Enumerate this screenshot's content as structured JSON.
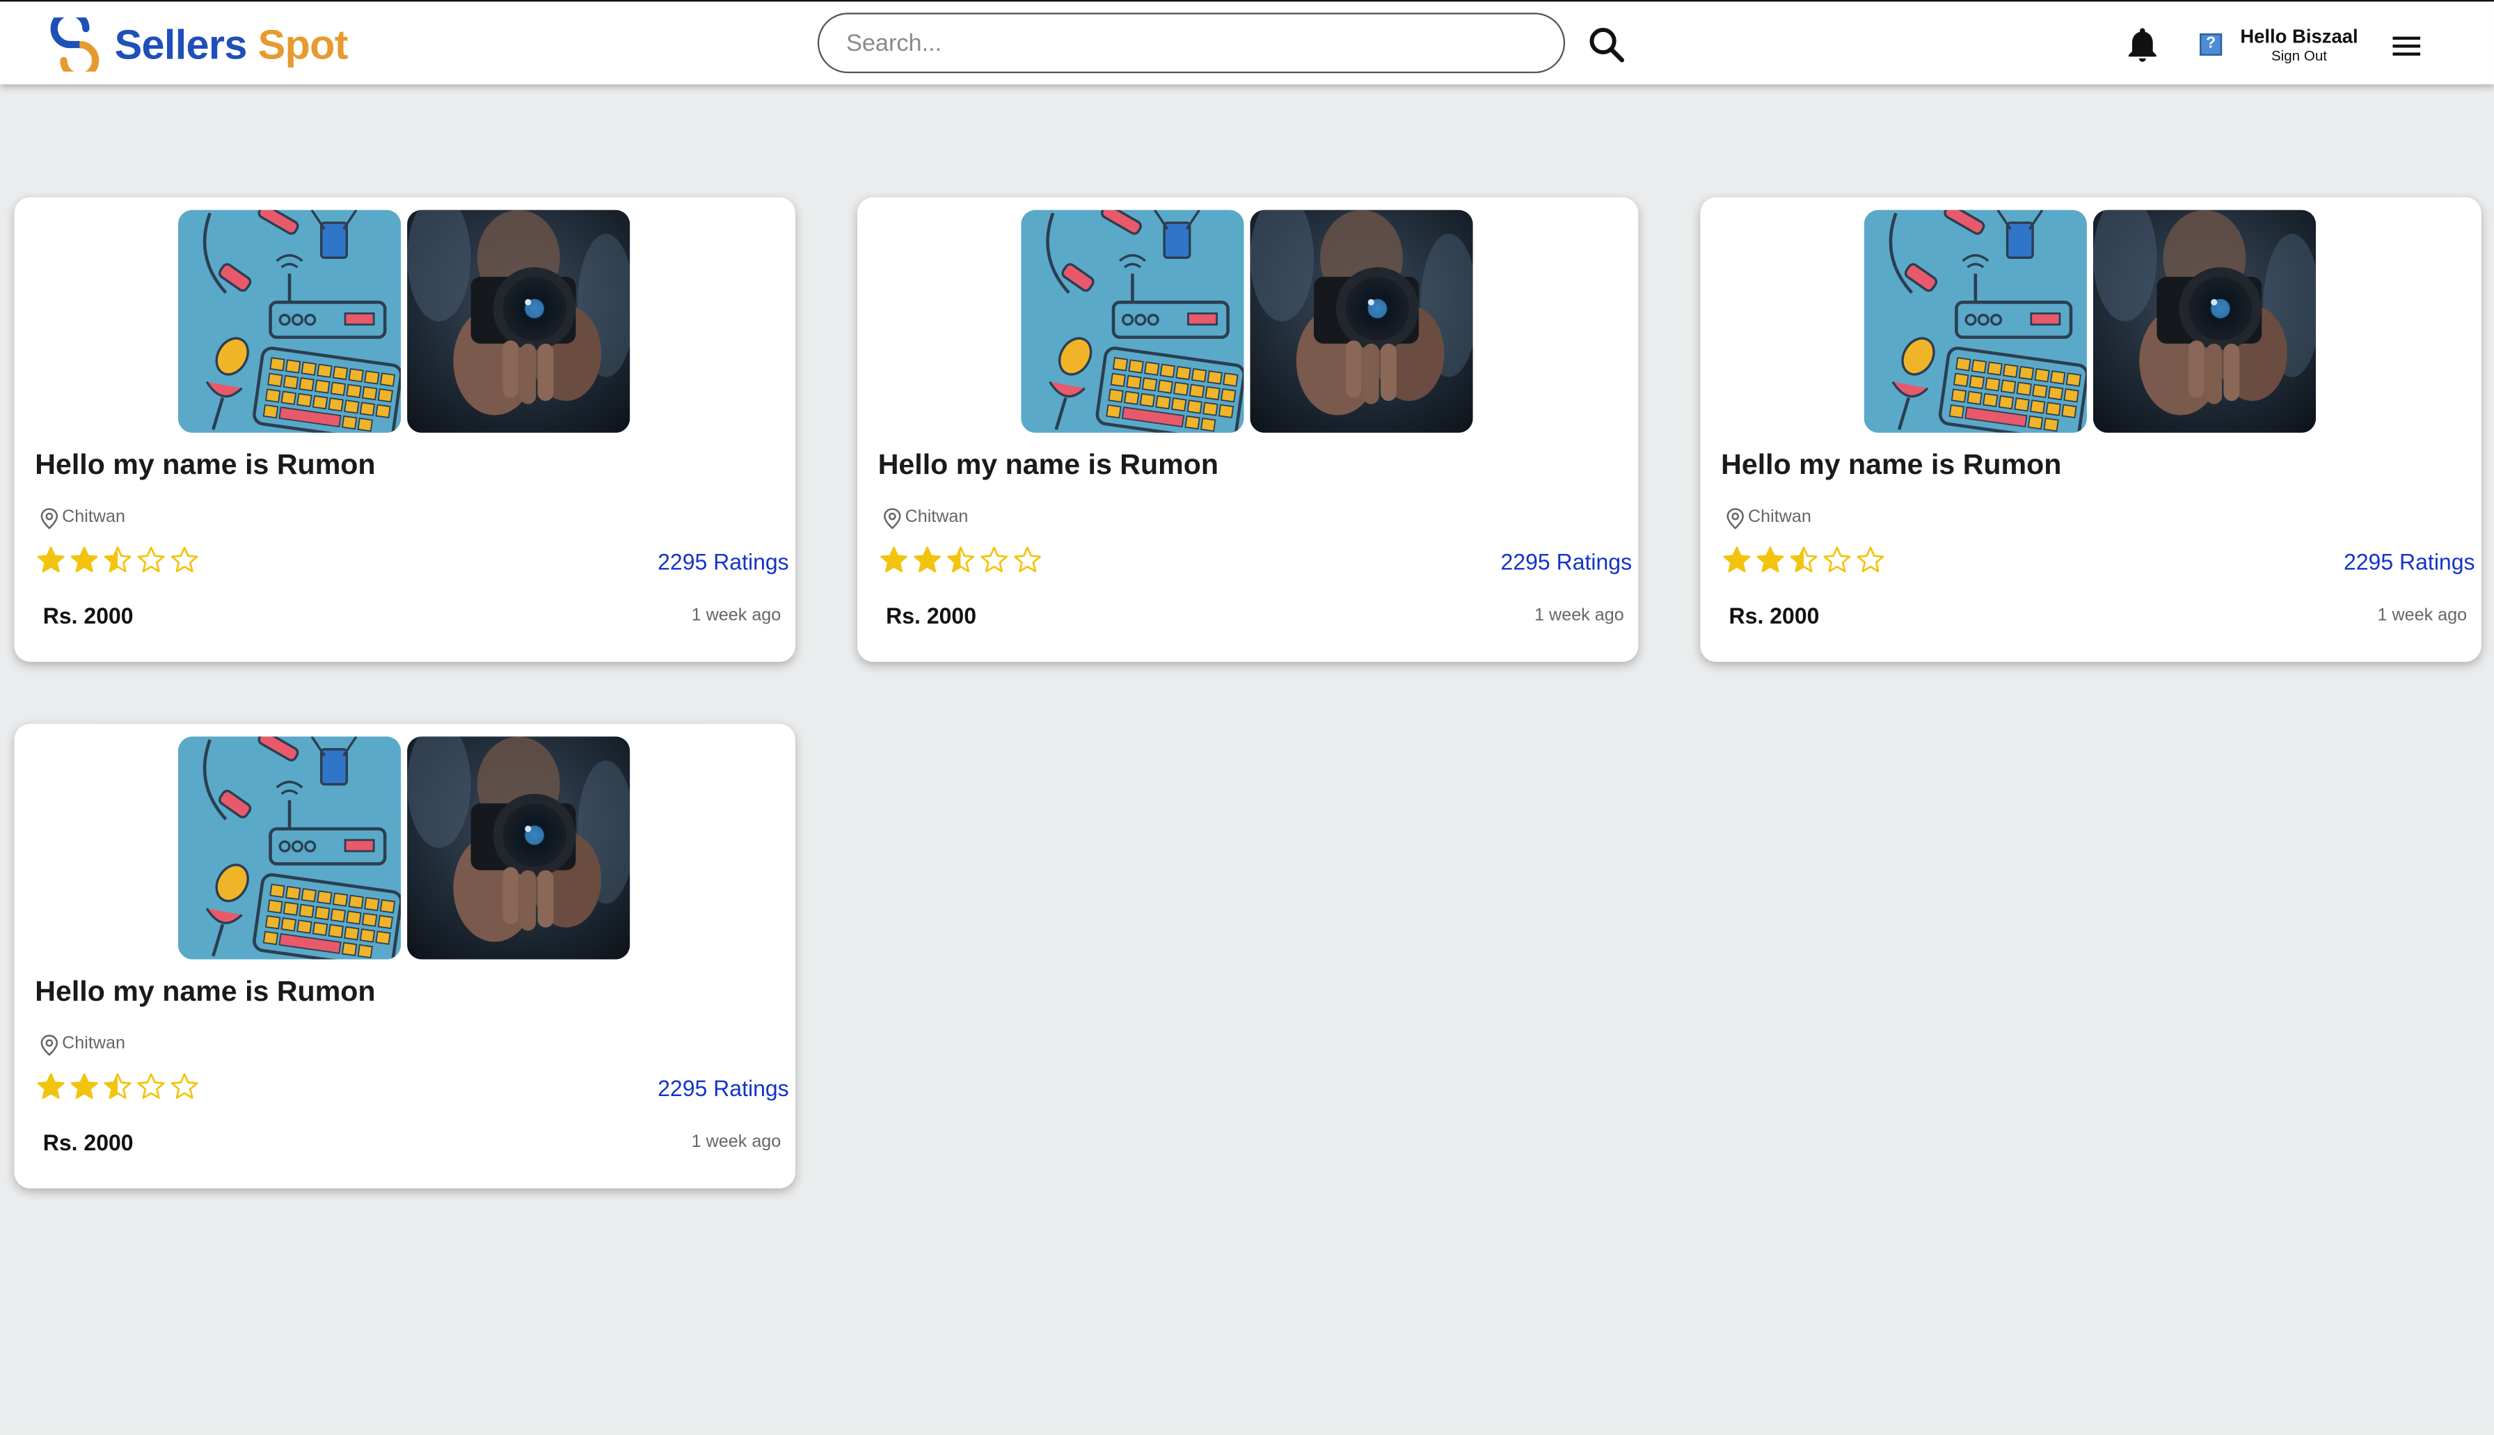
{
  "header": {
    "logo": {
      "word1": "Sellers",
      "word2": "Spot"
    },
    "search": {
      "placeholder": "Search...",
      "value": ""
    },
    "user": {
      "greeting": "Hello Biszaal",
      "signout_label": "Sign Out"
    }
  },
  "colors": {
    "brand_blue": "#1f4fb8",
    "brand_orange": "#e79a30",
    "star_yellow": "#f2c40f",
    "link_blue": "#1434c8",
    "background": "#ebeced"
  },
  "icons": {
    "search": "search-icon",
    "notifications": "bell-icon",
    "avatar": "broken-image-icon",
    "menu": "hamburger-menu-icon",
    "location": "location-pin-icon",
    "rating": "star-icon"
  },
  "listings": [
    {
      "title": "Hello my name is Rumon",
      "location": "Chitwan",
      "rating": 2.5,
      "rating_max": 5,
      "ratings_text": "2295 Ratings",
      "price": "Rs. 2000",
      "posted": "1 week ago"
    },
    {
      "title": "Hello my name is Rumon",
      "location": "Chitwan",
      "rating": 2.5,
      "rating_max": 5,
      "ratings_text": "2295 Ratings",
      "price": "Rs. 2000",
      "posted": "1 week ago"
    },
    {
      "title": "Hello my name is Rumon",
      "location": "Chitwan",
      "rating": 2.5,
      "rating_max": 5,
      "ratings_text": "2295 Ratings",
      "price": "Rs. 2000",
      "posted": "1 week ago"
    },
    {
      "title": "Hello my name is Rumon",
      "location": "Chitwan",
      "rating": 2.5,
      "rating_max": 5,
      "ratings_text": "2295 Ratings",
      "price": "Rs. 2000",
      "posted": "1 week ago"
    }
  ]
}
